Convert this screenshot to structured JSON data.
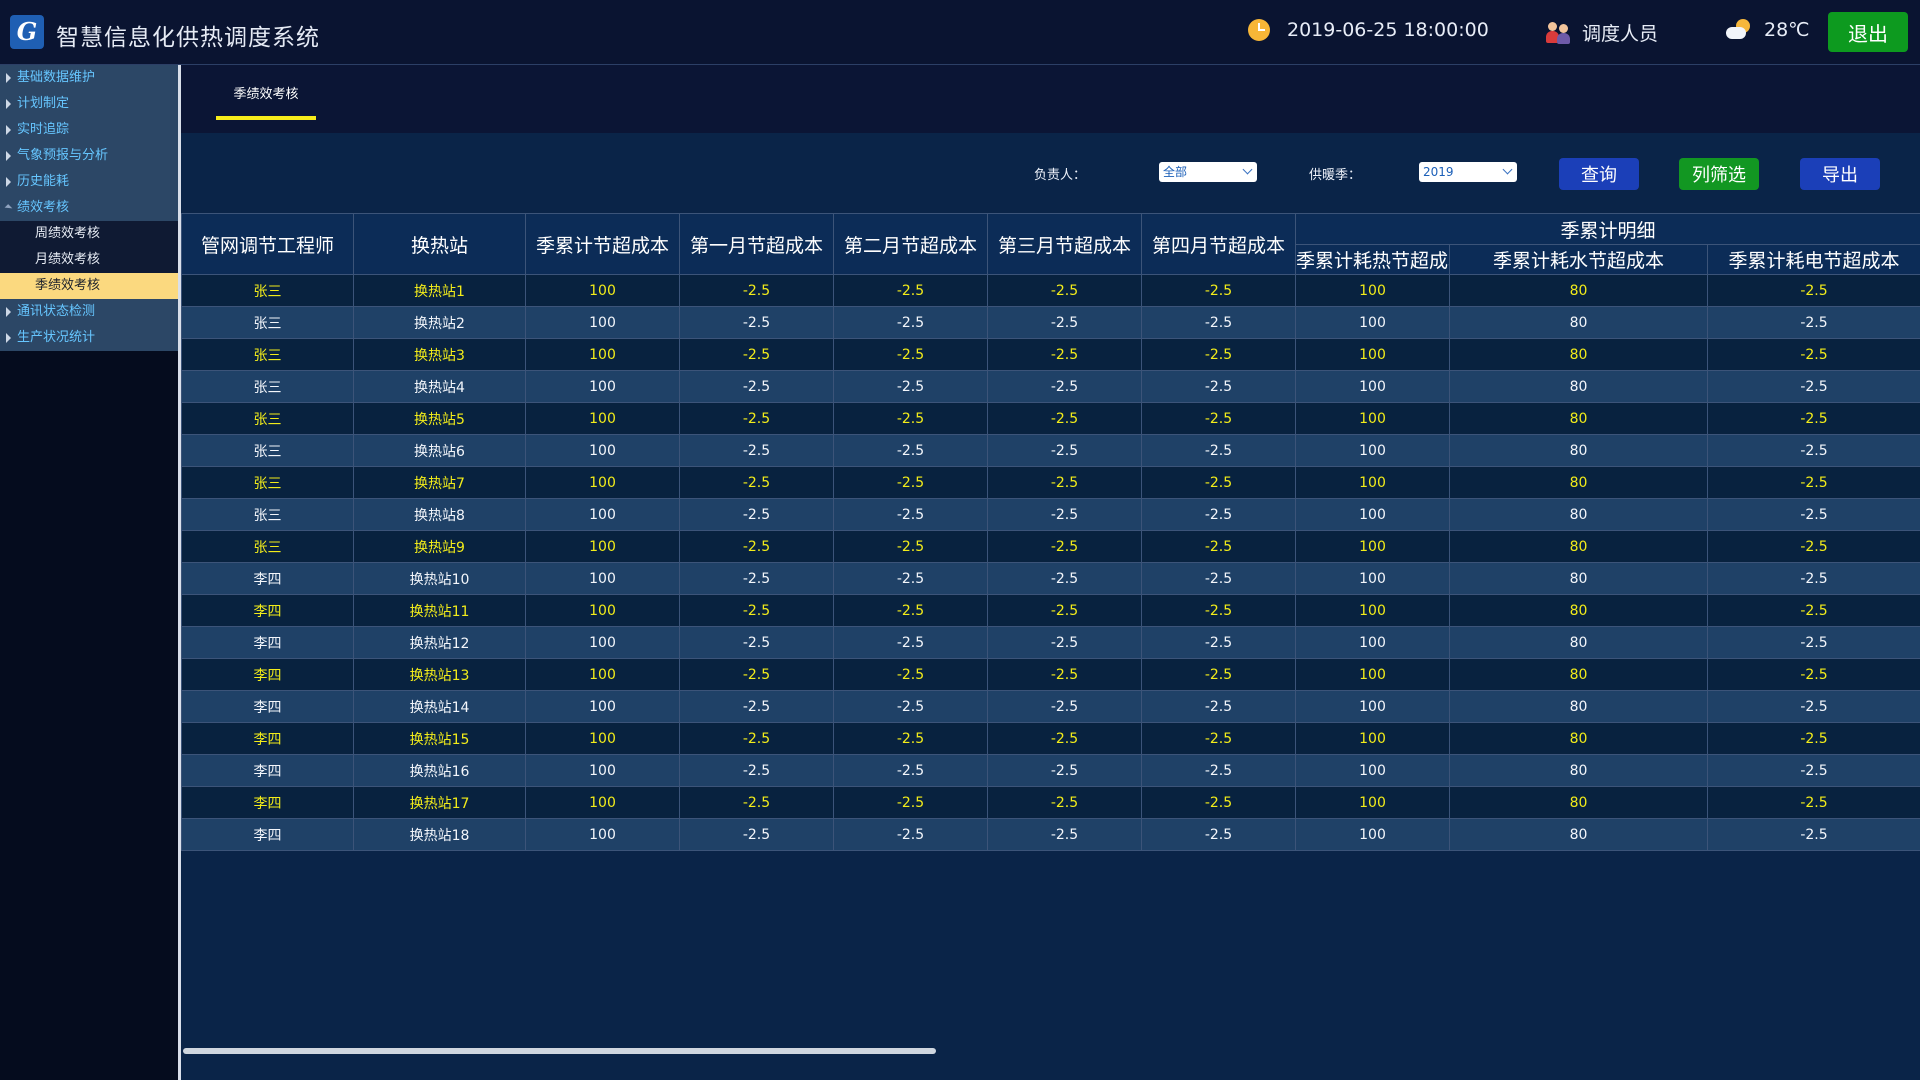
{
  "header": {
    "logo_glyph": "G",
    "title": "智慧信息化供热调度系统",
    "datetime": "2019-06-25 18:00:00",
    "user_role": "调度人员",
    "temperature": "28℃",
    "logout_label": "退出"
  },
  "sidebar": {
    "items": [
      {
        "label": "基础数据维护",
        "expanded": false
      },
      {
        "label": "计划制定",
        "expanded": false
      },
      {
        "label": "实时追踪",
        "expanded": false
      },
      {
        "label": "气象预报与分析",
        "expanded": false
      },
      {
        "label": "历史能耗",
        "expanded": false
      },
      {
        "label": "绩效考核",
        "expanded": true,
        "children": [
          {
            "label": "周绩效考核",
            "active": false
          },
          {
            "label": "月绩效考核",
            "active": false
          },
          {
            "label": "季绩效考核",
            "active": true
          }
        ]
      },
      {
        "label": "通讯状态检测",
        "expanded": false
      },
      {
        "label": "生产状况统计",
        "expanded": false
      }
    ]
  },
  "tabs": [
    {
      "label": "季绩效考核",
      "active": true
    }
  ],
  "filters": {
    "owner_label": "负责人：",
    "owner_value": "全部",
    "season_label": "供暖季：",
    "season_value": "2019",
    "query_label": "查询",
    "column_filter_label": "列筛选",
    "export_label": "导出"
  },
  "table": {
    "columns": [
      "管网调节工程师",
      "换热站",
      "季累计节超成本",
      "第一月节超成本",
      "第二月节超成本",
      "第三月节超成本",
      "第四月节超成本"
    ],
    "group_header": "季累计明细",
    "sub_columns": [
      "季累计耗热节超成本",
      "季累计耗水节超成本",
      "季累计耗电节超成本"
    ],
    "rows": [
      [
        "张三",
        "换热站1",
        "100",
        "-2.5",
        "-2.5",
        "-2.5",
        "-2.5",
        "100",
        "80",
        "-2.5"
      ],
      [
        "张三",
        "换热站2",
        "100",
        "-2.5",
        "-2.5",
        "-2.5",
        "-2.5",
        "100",
        "80",
        "-2.5"
      ],
      [
        "张三",
        "换热站3",
        "100",
        "-2.5",
        "-2.5",
        "-2.5",
        "-2.5",
        "100",
        "80",
        "-2.5"
      ],
      [
        "张三",
        "换热站4",
        "100",
        "-2.5",
        "-2.5",
        "-2.5",
        "-2.5",
        "100",
        "80",
        "-2.5"
      ],
      [
        "张三",
        "换热站5",
        "100",
        "-2.5",
        "-2.5",
        "-2.5",
        "-2.5",
        "100",
        "80",
        "-2.5"
      ],
      [
        "张三",
        "换热站6",
        "100",
        "-2.5",
        "-2.5",
        "-2.5",
        "-2.5",
        "100",
        "80",
        "-2.5"
      ],
      [
        "张三",
        "换热站7",
        "100",
        "-2.5",
        "-2.5",
        "-2.5",
        "-2.5",
        "100",
        "80",
        "-2.5"
      ],
      [
        "张三",
        "换热站8",
        "100",
        "-2.5",
        "-2.5",
        "-2.5",
        "-2.5",
        "100",
        "80",
        "-2.5"
      ],
      [
        "张三",
        "换热站9",
        "100",
        "-2.5",
        "-2.5",
        "-2.5",
        "-2.5",
        "100",
        "80",
        "-2.5"
      ],
      [
        "李四",
        "换热站10",
        "100",
        "-2.5",
        "-2.5",
        "-2.5",
        "-2.5",
        "100",
        "80",
        "-2.5"
      ],
      [
        "李四",
        "换热站11",
        "100",
        "-2.5",
        "-2.5",
        "-2.5",
        "-2.5",
        "100",
        "80",
        "-2.5"
      ],
      [
        "李四",
        "换热站12",
        "100",
        "-2.5",
        "-2.5",
        "-2.5",
        "-2.5",
        "100",
        "80",
        "-2.5"
      ],
      [
        "李四",
        "换热站13",
        "100",
        "-2.5",
        "-2.5",
        "-2.5",
        "-2.5",
        "100",
        "80",
        "-2.5"
      ],
      [
        "李四",
        "换热站14",
        "100",
        "-2.5",
        "-2.5",
        "-2.5",
        "-2.5",
        "100",
        "80",
        "-2.5"
      ],
      [
        "李四",
        "换热站15",
        "100",
        "-2.5",
        "-2.5",
        "-2.5",
        "-2.5",
        "100",
        "80",
        "-2.5"
      ],
      [
        "李四",
        "换热站16",
        "100",
        "-2.5",
        "-2.5",
        "-2.5",
        "-2.5",
        "100",
        "80",
        "-2.5"
      ],
      [
        "李四",
        "换热站17",
        "100",
        "-2.5",
        "-2.5",
        "-2.5",
        "-2.5",
        "100",
        "80",
        "-2.5"
      ],
      [
        "李四",
        "换热站18",
        "100",
        "-2.5",
        "-2.5",
        "-2.5",
        "-2.5",
        "100",
        "80",
        "-2.5"
      ]
    ]
  },
  "colors": {
    "accent_green": "#0d9a1f",
    "accent_blue": "#1b3fb8",
    "highlight_yellow": "#f2ec1a",
    "active_menu": "#fbd97f"
  }
}
